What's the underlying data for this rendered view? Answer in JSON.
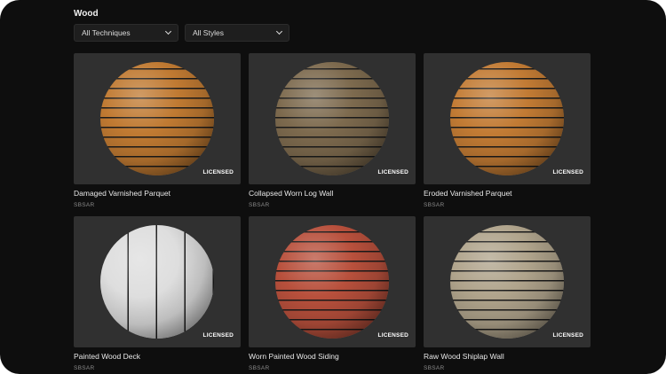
{
  "category_title": "Wood",
  "filters": [
    {
      "label": "All Techniques"
    },
    {
      "label": "All Styles"
    }
  ],
  "materials": [
    {
      "name": "Damaged Varnished Parquet",
      "type": "SBSAR",
      "badge": "LICENSED",
      "color": "#c07a32",
      "stripe": "horizontal"
    },
    {
      "name": "Collapsed Worn Log Wall",
      "type": "SBSAR",
      "badge": "LICENSED",
      "color": "#7d6a4e",
      "stripe": "horizontal"
    },
    {
      "name": "Eroded Varnished Parquet",
      "type": "SBSAR",
      "badge": "LICENSED",
      "color": "#c27b34",
      "stripe": "horizontal"
    },
    {
      "name": "Painted Wood Deck",
      "type": "SBSAR",
      "badge": "LICENSED",
      "color": "#dedede",
      "stripe": "vertical"
    },
    {
      "name": "Worn Painted Wood Siding",
      "type": "SBSAR",
      "badge": "LICENSED",
      "color": "#b8503c",
      "stripe": "horizontal"
    },
    {
      "name": "Raw Wood Shiplap Wall",
      "type": "SBSAR",
      "badge": "LICENSED",
      "color": "#b0a48c",
      "stripe": "horizontal"
    }
  ]
}
